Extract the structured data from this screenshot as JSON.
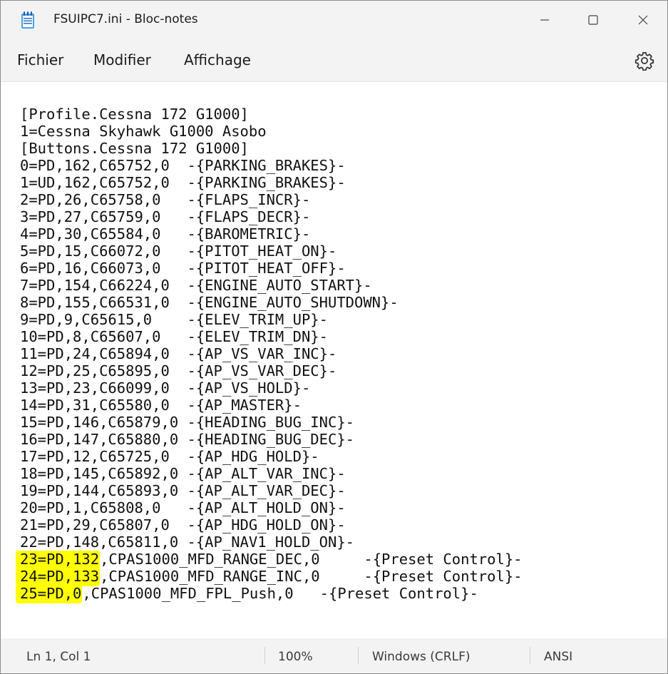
{
  "window": {
    "title": "FSUIPC7.ini - Bloc-notes",
    "icons": {
      "app": "notepad-icon",
      "minimize": "minimize-icon",
      "maximize": "maximize-icon",
      "close": "close-icon",
      "settings": "gear-icon"
    }
  },
  "menu": {
    "items": [
      "Fichier",
      "Modifier",
      "Affichage"
    ]
  },
  "editor": {
    "highlight_color": "#ffff00",
    "lines": [
      {
        "text": "[Profile.Cessna 172 G1000]"
      },
      {
        "text": "1=Cessna Skyhawk G1000 Asobo"
      },
      {
        "text": "[Buttons.Cessna 172 G1000]"
      },
      {
        "text": "0=PD,162,C65752,0  -{PARKING_BRAKES}-"
      },
      {
        "text": "1=UD,162,C65752,0  -{PARKING_BRAKES}-"
      },
      {
        "text": "2=PD,26,C65758,0   -{FLAPS_INCR}-"
      },
      {
        "text": "3=PD,27,C65759,0   -{FLAPS_DECR}-"
      },
      {
        "text": "4=PD,30,C65584,0   -{BAROMETRIC}-"
      },
      {
        "text": "5=PD,15,C66072,0   -{PITOT_HEAT_ON}-"
      },
      {
        "text": "6=PD,16,C66073,0   -{PITOT_HEAT_OFF}-"
      },
      {
        "text": "7=PD,154,C66224,0  -{ENGINE_AUTO_START}-"
      },
      {
        "text": "8=PD,155,C66531,0  -{ENGINE_AUTO_SHUTDOWN}-"
      },
      {
        "text": "9=PD,9,C65615,0    -{ELEV_TRIM_UP}-"
      },
      {
        "text": "10=PD,8,C65607,0   -{ELEV_TRIM_DN}-"
      },
      {
        "text": "11=PD,24,C65894,0  -{AP_VS_VAR_INC}-"
      },
      {
        "text": "12=PD,25,C65895,0  -{AP_VS_VAR_DEC}-"
      },
      {
        "text": "13=PD,23,C66099,0  -{AP_VS_HOLD}-"
      },
      {
        "text": "14=PD,31,C65580,0  -{AP_MASTER}-"
      },
      {
        "text": "15=PD,146,C65879,0 -{HEADING_BUG_INC}-"
      },
      {
        "text": "16=PD,147,C65880,0 -{HEADING_BUG_DEC}-"
      },
      {
        "text": "17=PD,12,C65725,0  -{AP_HDG_HOLD}-"
      },
      {
        "text": "18=PD,145,C65892,0 -{AP_ALT_VAR_INC}-"
      },
      {
        "text": "19=PD,144,C65893,0 -{AP_ALT_VAR_DEC}-"
      },
      {
        "text": "20=PD,1,C65808,0   -{AP_ALT_HOLD_ON}-"
      },
      {
        "text": "21=PD,29,C65807,0  -{AP_HDG_HOLD_ON}-"
      },
      {
        "text": "22=PD,148,C65811,0 -{AP_NAV1_HOLD_ON}-"
      },
      {
        "highlight": "23=PD,132",
        "text": ",CPAS1000_MFD_RANGE_DEC,0     -{Preset Control}-"
      },
      {
        "highlight": "24=PD,133",
        "text": ",CPAS1000_MFD_RANGE_INC,0     -{Preset Control}-"
      },
      {
        "highlight": "25=PD,0",
        "text": ",CPAS1000_MFD_FPL_Push,0   -{Preset Control}-"
      }
    ]
  },
  "status": {
    "position": "Ln 1, Col 1",
    "zoom": "100%",
    "line_endings": "Windows (CRLF)",
    "encoding": "ANSI"
  }
}
